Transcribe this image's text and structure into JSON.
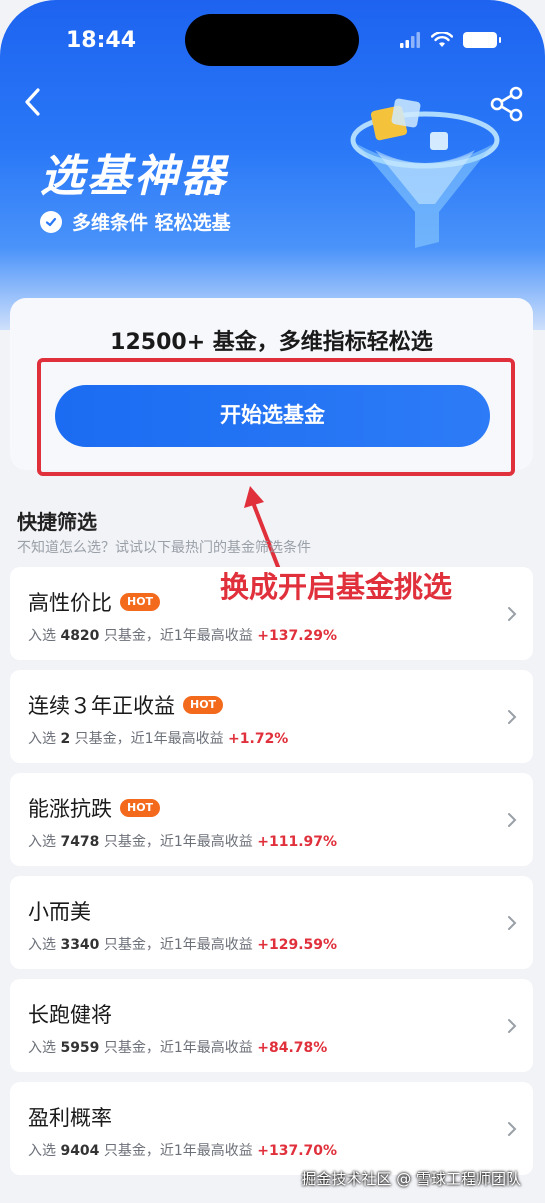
{
  "status_bar": {
    "time": "18:44"
  },
  "header": {
    "title": "选基神器",
    "subtitle": "多维条件 轻松选基"
  },
  "main_card": {
    "headline": "12500+ 基金，多维指标轻松选",
    "button_label": "开始选基金"
  },
  "annotation": "换成开启基金挑选",
  "quick_filter": {
    "title": "快捷筛选",
    "subtitle": "不知道怎么选？试试以下最热门的基金筛选条件",
    "hot_label": "HOT",
    "items": [
      {
        "name": "高性价比",
        "hot": true,
        "prefix": "入选",
        "count": "4820",
        "mid": "只基金，近1年最高收益",
        "pct": "+137.29%"
      },
      {
        "name": "连续３年正收益",
        "hot": true,
        "prefix": "入选",
        "count": "2",
        "mid": "只基金，近1年最高收益",
        "pct": "+1.72%"
      },
      {
        "name": "能涨抗跌",
        "hot": true,
        "prefix": "入选",
        "count": "7478",
        "mid": "只基金，近1年最高收益",
        "pct": "+111.97%"
      },
      {
        "name": "小而美",
        "hot": false,
        "prefix": "入选",
        "count": "3340",
        "mid": "只基金，近1年最高收益",
        "pct": "+129.59%"
      },
      {
        "name": "长跑健将",
        "hot": false,
        "prefix": "入选",
        "count": "5959",
        "mid": "只基金，近1年最高收益",
        "pct": "+84.78%"
      },
      {
        "name": "盈利概率",
        "hot": false,
        "prefix": "入选",
        "count": "9404",
        "mid": "只基金，近1年最高收益",
        "pct": "+137.70%"
      }
    ]
  },
  "watermark": "掘金技术社区 @ 雪球工程师团队",
  "icons": {
    "back": "chevron-left-icon",
    "share": "share-icon",
    "check": "check-circle-icon",
    "item_arrow": "chevron-right-icon"
  },
  "colors": {
    "brand_blue": "#1b6cf2",
    "annotation_red": "#e0303b",
    "hot_orange": "#f36a1c"
  }
}
